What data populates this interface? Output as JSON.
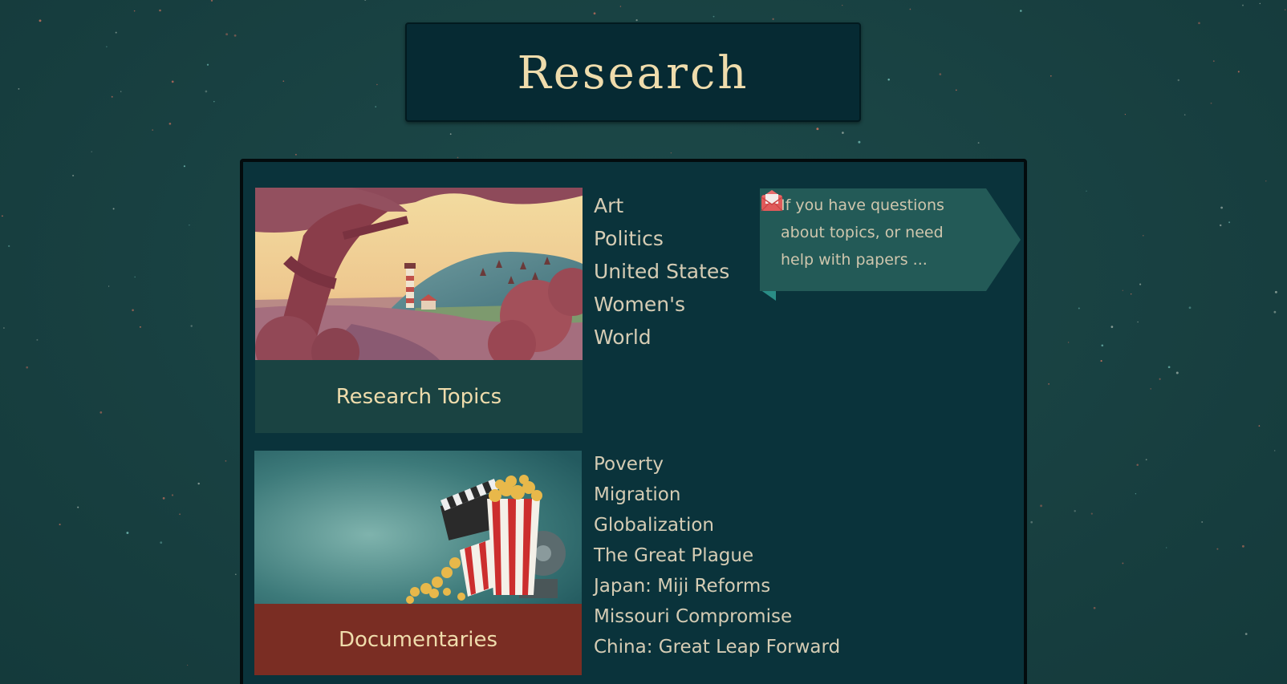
{
  "header": {
    "title": "Research"
  },
  "topics_card": {
    "caption": "Research Topics",
    "image_icon": "lighthouse-landscape-illustration"
  },
  "topics": [
    "Art",
    "Politics",
    "United States",
    "Women's",
    "World"
  ],
  "help_callout": {
    "text": "If you have questions about topics, or need help with papers ...",
    "icon": "mail-icon"
  },
  "documentaries_card": {
    "caption": "Documentaries",
    "image_icon": "popcorn-clapperboard-illustration"
  },
  "documentaries": [
    "Poverty",
    "Migration",
    "Globalization",
    "The Great Plague",
    "Japan: Miji Reforms",
    "Missouri Compromise",
    "China: Great Leap Forward"
  ],
  "colors": {
    "background": "#1b4545",
    "panel": "#0a333b",
    "title_box": "#062a33",
    "accent_text": "#efdcac",
    "callout": "#235a57",
    "documentaries_caption_bg": "#7a2d23",
    "mail_icon": "#e05a5a"
  }
}
